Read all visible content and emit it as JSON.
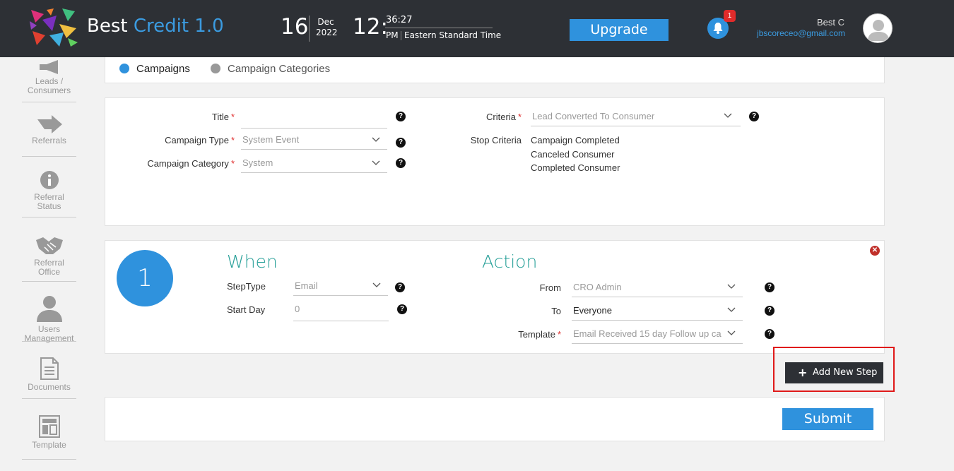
{
  "header": {
    "app_title_main": "Best",
    "app_title_accent": "Credit 1.0",
    "date_day": "16",
    "date_month": "Dec",
    "date_year": "2022",
    "time_hour": "12:",
    "time_minutes": "36:27",
    "time_ampm": "PM",
    "timezone": "Eastern Standard Time",
    "upgrade_label": "Upgrade",
    "notification_count": "1",
    "user_name": "Best C",
    "user_email": "jbscoreceo@gmail.com"
  },
  "sidebar": {
    "items": [
      {
        "label": "Leads / Consumers",
        "icon": "megaphone-icon"
      },
      {
        "label": "Referrals",
        "icon": "arrow-icon"
      },
      {
        "label": "Referral Status",
        "icon": "info-icon"
      },
      {
        "label": "Referral Office",
        "icon": "handshake-icon"
      },
      {
        "label": "Users Management",
        "icon": "user-icon"
      },
      {
        "label": "Documents",
        "icon": "document-icon"
      },
      {
        "label": "Template",
        "icon": "template-icon"
      }
    ]
  },
  "tabs": [
    {
      "label": "Campaigns",
      "active": true
    },
    {
      "label": "Campaign Categories",
      "active": false
    }
  ],
  "campaign_form": {
    "title_label": "Title",
    "title_value": "",
    "type_label": "Campaign Type",
    "type_value": "System Event",
    "category_label": "Campaign Category",
    "category_value": "System",
    "criteria_label": "Criteria",
    "criteria_value": "Lead Converted To Consumer",
    "stop_criteria_label": "Stop Criteria",
    "stop_criteria": [
      "Campaign Completed",
      "Canceled Consumer",
      "Completed Consumer"
    ]
  },
  "step": {
    "number": "1",
    "when_heading": "When",
    "action_heading": "Action",
    "steptype_label": "StepType",
    "steptype_value": "Email",
    "startday_label": "Start Day",
    "startday_value": "0",
    "from_label": "From",
    "from_value": "CRO Admin",
    "to_label": "To",
    "to_value": "Everyone",
    "template_label": "Template",
    "template_value": "Email Received 15 day Follow up ca"
  },
  "buttons": {
    "add_step": "Add New Step",
    "submit": "Submit"
  },
  "colors": {
    "header_bg": "#2d3035",
    "accent_blue": "#2f92dd",
    "teal_heading": "#2aa19a",
    "required_red": "#e03030"
  }
}
